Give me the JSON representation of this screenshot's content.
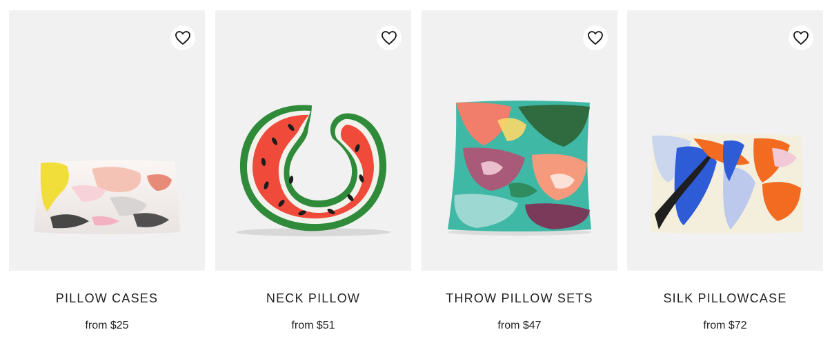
{
  "products": [
    {
      "name": "PILLOW CASES",
      "price": "from $25",
      "icon": "heart-outline-icon"
    },
    {
      "name": "NECK PILLOW",
      "price": "from $51",
      "icon": "heart-outline-icon"
    },
    {
      "name": "THROW PILLOW SETS",
      "price": "from $47",
      "icon": "heart-outline-icon"
    },
    {
      "name": "SILK PILLOWCASE",
      "price": "from $72",
      "icon": "heart-outline-icon"
    }
  ],
  "colors": {
    "card_background": "#f1f1f1",
    "text": "#1f1f1f"
  }
}
